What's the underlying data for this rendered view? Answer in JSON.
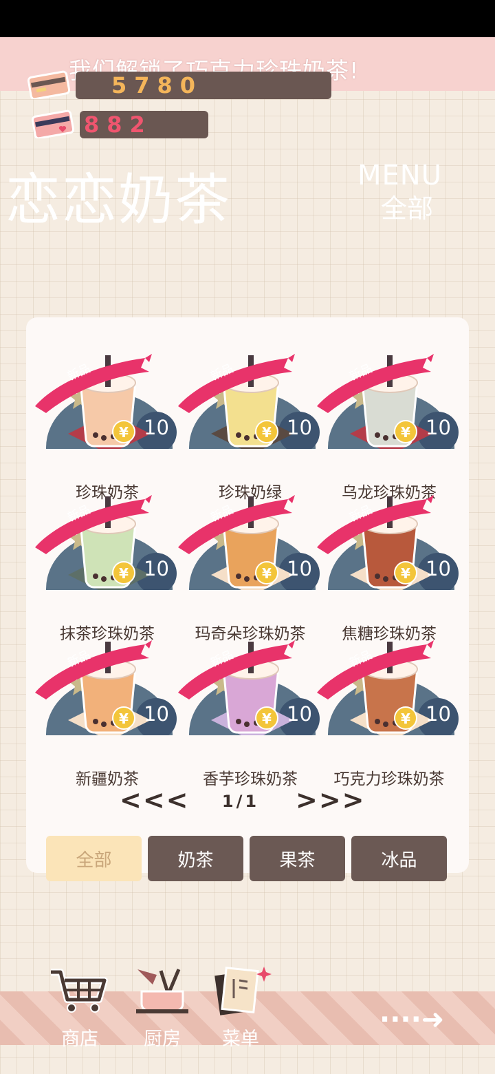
{
  "notification": "我们解锁了巧克力珍珠奶茶!",
  "currencies": {
    "coins": "5780",
    "hearts": "882"
  },
  "shop": {
    "title": "恋恋奶茶",
    "menu_label": "MENU",
    "category": "全部"
  },
  "items": [
    {
      "name": "珍珠奶茶",
      "badge": "新品",
      "price": "10",
      "drink_color": "#f6c9a8",
      "tray_color": "#b43c49"
    },
    {
      "name": "珍珠奶绿",
      "badge": "新品",
      "price": "10",
      "drink_color": "#f3e08f",
      "tray_color": "#5a4a42"
    },
    {
      "name": "乌龙珍珠奶茶",
      "badge": "新品",
      "price": "10",
      "drink_color": "#d9dcd3",
      "tray_color": "#b43c49"
    },
    {
      "name": "抹茶珍珠奶茶",
      "badge": "新品",
      "price": "10",
      "drink_color": "#cfe3b7",
      "tray_color": "#5d6f68"
    },
    {
      "name": "玛奇朵珍珠奶茶",
      "badge": "新品",
      "price": "10",
      "drink_color": "#e9a35c",
      "tray_color": "#f5dfc8"
    },
    {
      "name": "焦糖珍珠奶茶",
      "badge": "新品",
      "price": "10",
      "drink_color": "#b8593c",
      "tray_color": "#f5dfc8"
    },
    {
      "name": "新疆奶茶",
      "badge": "新品",
      "price": "10",
      "drink_color": "#f2b17a",
      "tray_color": "#f5dfc8"
    },
    {
      "name": "香芋珍珠奶茶",
      "badge": "新品",
      "price": "10",
      "drink_color": "#d9a7d6",
      "tray_color": "#c9b2dc"
    },
    {
      "name": "巧克力珍珠奶茶",
      "badge": "新品",
      "price": "10",
      "drink_color": "#c8744b",
      "tray_color": "#f5dfc8"
    }
  ],
  "pagination": {
    "prev": "<<<",
    "page": "1/1",
    "next": ">>>"
  },
  "tabs": [
    {
      "label": "全部",
      "active": true
    },
    {
      "label": "奶茶",
      "active": false
    },
    {
      "label": "果茶",
      "active": false
    },
    {
      "label": "冰品",
      "active": false
    }
  ],
  "nav": [
    {
      "label": "商店",
      "icon": "cart-icon"
    },
    {
      "label": "厨房",
      "icon": "kitchen-icon"
    },
    {
      "label": "菜单",
      "icon": "menu-book-icon"
    }
  ],
  "next_icon": "arrow-right-icon"
}
